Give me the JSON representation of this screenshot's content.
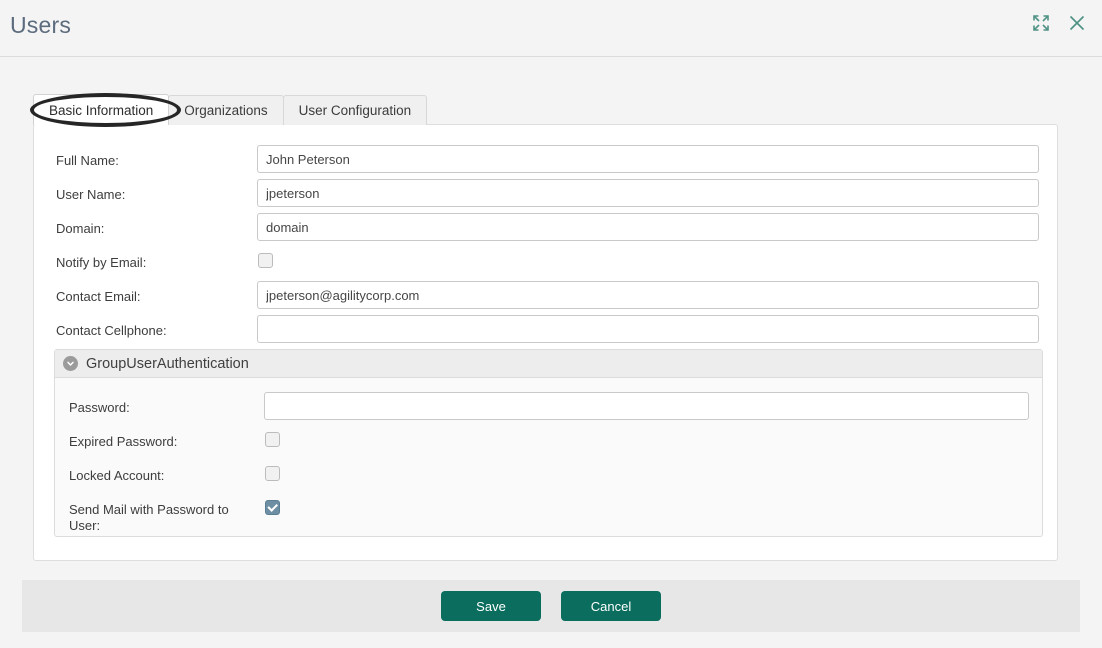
{
  "header": {
    "title": "Users",
    "actions": [
      {
        "name": "expand-icon",
        "label": "Expand"
      },
      {
        "name": "close-icon",
        "label": "Close"
      }
    ],
    "accent_color": "#4f9184"
  },
  "tabs": [
    {
      "label": "Basic Information",
      "active": true
    },
    {
      "label": "Organizations",
      "active": false
    },
    {
      "label": "User Configuration",
      "active": false
    }
  ],
  "form": {
    "fields": [
      {
        "label": "Full Name:",
        "value": "John Peterson",
        "type": "text"
      },
      {
        "label": "User Name:",
        "value": "jpeterson",
        "type": "text"
      },
      {
        "label": "Domain:",
        "value": "domain",
        "type": "text"
      },
      {
        "label": "Notify by Email:",
        "checked": false,
        "type": "checkbox"
      },
      {
        "label": "Contact Email:",
        "value": "jpeterson@agilitycorp.com",
        "type": "text"
      },
      {
        "label": "Contact Cellphone:",
        "value": "",
        "type": "text"
      }
    ]
  },
  "group": {
    "title": "GroupUserAuthentication",
    "expanded": true,
    "fields": [
      {
        "label": "Password:",
        "value": "",
        "type": "text"
      },
      {
        "label": "Expired Password:",
        "checked": false,
        "type": "checkbox"
      },
      {
        "label": "Locked Account:",
        "checked": false,
        "type": "checkbox"
      },
      {
        "label": "Send Mail with Password to User:",
        "checked": true,
        "type": "checkbox"
      }
    ]
  },
  "footer": {
    "save_label": "Save",
    "cancel_label": "Cancel",
    "button_color": "#0a6d5d"
  }
}
